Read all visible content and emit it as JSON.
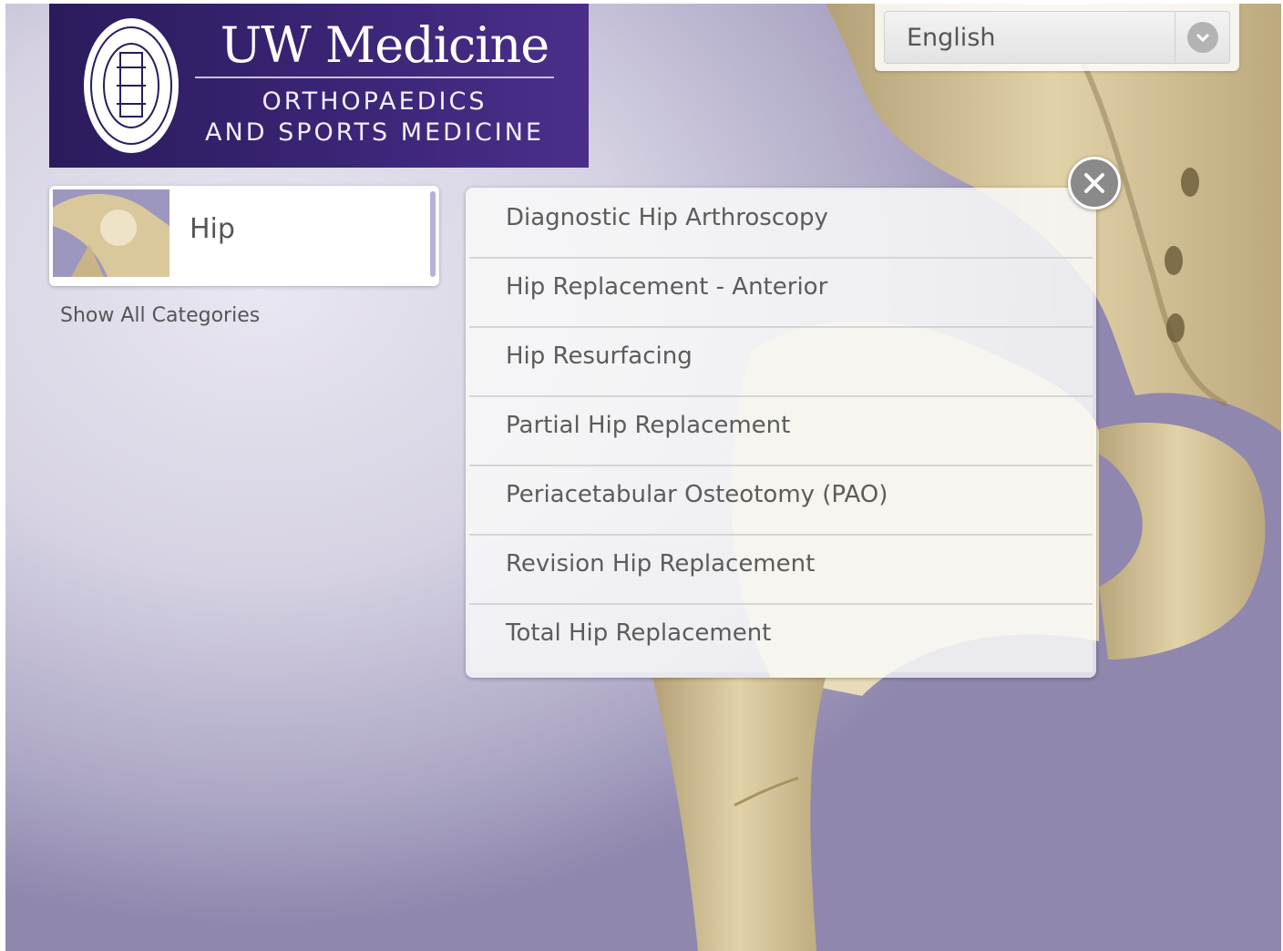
{
  "logo": {
    "title": "UW Medicine",
    "subtitle_line1": "ORTHOPAEDICS",
    "subtitle_line2": "AND SPORTS MEDICINE",
    "seal_icon": "university-seal-icon"
  },
  "language": {
    "selected": "English",
    "chevron_icon": "chevron-down-icon"
  },
  "category": {
    "label": "Hip",
    "thumbnail_icon": "hip-thumbnail"
  },
  "show_all": "Show All Categories",
  "procedures": [
    "Diagnostic Hip Arthroscopy",
    "Hip Replacement - Anterior",
    "Hip Resurfacing",
    "Partial Hip Replacement",
    "Periacetabular Osteotomy (PAO)",
    "Revision Hip Replacement",
    "Total Hip Replacement"
  ],
  "close_icon": "close-icon",
  "colors": {
    "logo_bg": "#3a2576",
    "accent_bar": "#b6b1d6",
    "text": "#5c5c5c"
  }
}
